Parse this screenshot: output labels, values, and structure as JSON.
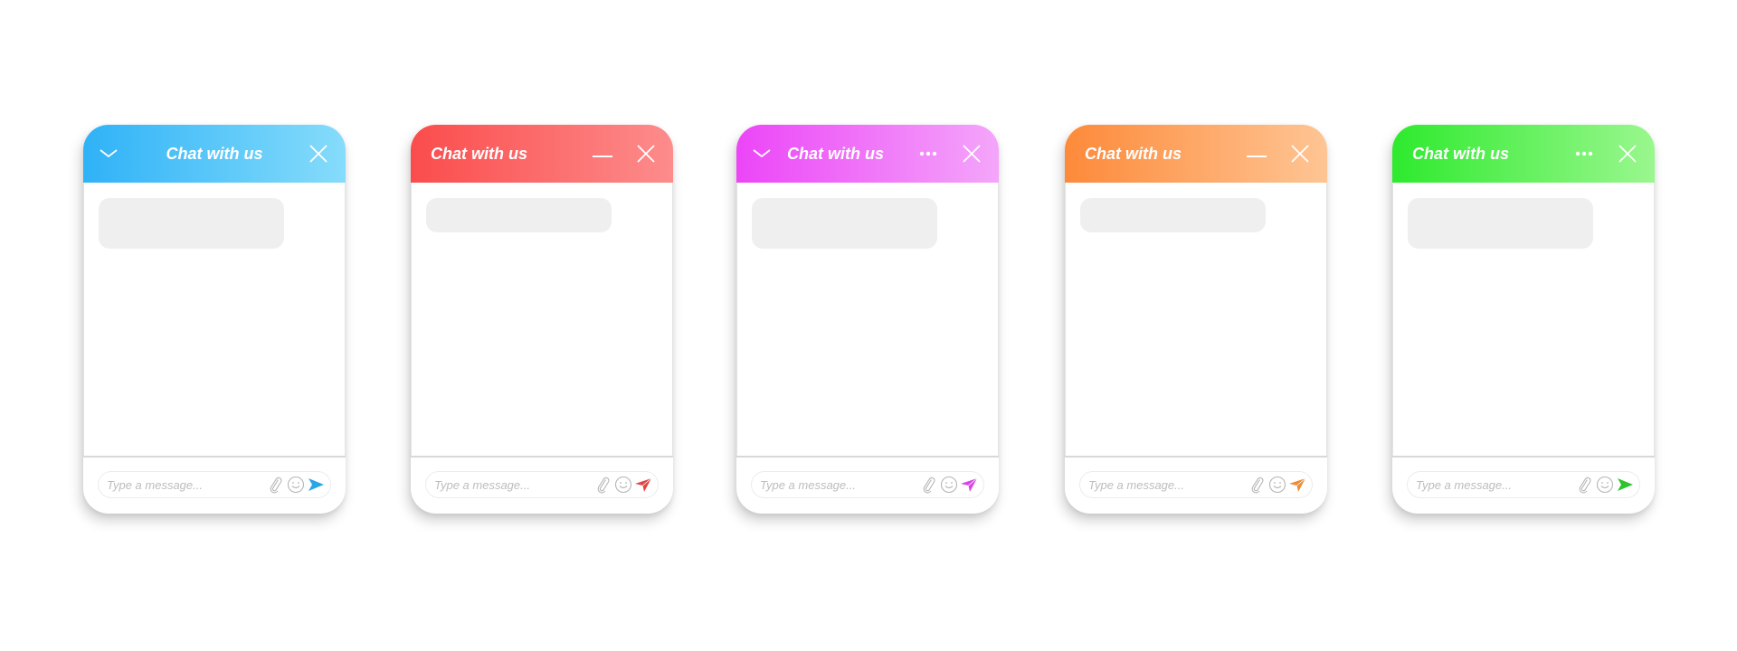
{
  "widgets": [
    {
      "id": "blue",
      "title": "Chat with us",
      "title_align": "center",
      "left_icon": "chevron-down-icon",
      "right_icons": [
        "close-icon"
      ],
      "gradient": [
        "#2fb2f7",
        "#86dcfb"
      ],
      "send_color": "#2aa6e6",
      "send_style": "arrow",
      "bubble": "tall",
      "input_placeholder": "Type a message..."
    },
    {
      "id": "red",
      "title": "Chat with us",
      "title_align": "left",
      "left_icon": null,
      "right_icons": [
        "minimize-icon",
        "close-icon"
      ],
      "gradient": [
        "#fb4c4c",
        "#fd8c8c"
      ],
      "send_color": "#e24545",
      "send_style": "plane",
      "bubble": "short",
      "input_placeholder": "Type a message..."
    },
    {
      "id": "magenta",
      "title": "Chat with us",
      "title_align": "left-after-icon",
      "left_icon": "chevron-down-icon",
      "right_icons": [
        "more-icon",
        "close-icon"
      ],
      "gradient": [
        "#ec45f7",
        "#f4a6fa"
      ],
      "send_color": "#d845e6",
      "send_style": "plane",
      "bubble": "tall",
      "input_placeholder": "Type a message..."
    },
    {
      "id": "orange",
      "title": "Chat with us",
      "title_align": "left",
      "left_icon": null,
      "right_icons": [
        "minimize-icon",
        "close-icon"
      ],
      "gradient": [
        "#fd8a3a",
        "#fec594"
      ],
      "send_color": "#ef8a35",
      "send_style": "plane",
      "bubble": "short",
      "input_placeholder": "Type a message..."
    },
    {
      "id": "green",
      "title": "Chat with us",
      "title_align": "left",
      "left_icon": null,
      "right_icons": [
        "more-icon",
        "close-icon"
      ],
      "gradient": [
        "#2eea2e",
        "#9af78e"
      ],
      "send_color": "#2ec42e",
      "send_style": "arrow",
      "bubble": "tall",
      "input_placeholder": "Type a message..."
    }
  ]
}
